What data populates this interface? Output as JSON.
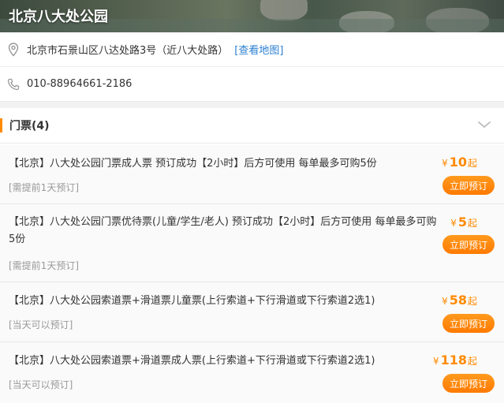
{
  "header": {
    "title": "北京八大处公园"
  },
  "address": {
    "text": "北京市石景山区八达处路3号（近八大处路）",
    "map_link": "[查看地图]",
    "icon": "location-pin-icon"
  },
  "phone": {
    "text": "010-88964661-2186",
    "icon": "phone-icon"
  },
  "tickets_section": {
    "label": "门票(4)",
    "icon": "chevron-down-icon",
    "accent": "#ff8a00"
  },
  "tickets": [
    {
      "name": "【北京】八大处公园门票成人票 预订成功【2小时】后方可使用 每单最多可购5份",
      "note": "[需提前1天预订]",
      "currency": "¥",
      "price": "10",
      "unit": "起",
      "button": "立即预订"
    },
    {
      "name": "【北京】八大处公园门票优待票(儿童/学生/老人) 预订成功【2小时】后方可使用 每单最多可购5份",
      "note": "[需提前1天预订]",
      "currency": "¥",
      "price": "5",
      "unit": "起",
      "button": "立即预订"
    },
    {
      "name": "【北京】八大处公园索道票+滑道票儿童票(上行索道+下行滑道或下行索道2选1)",
      "note": "[当天可以预订]",
      "currency": "¥",
      "price": "58",
      "unit": "起",
      "button": "立即预订"
    },
    {
      "name": "【北京】八大处公园索道票+滑道票成人票(上行索道+下行滑道或下行索道2选1)",
      "note": "[当天可以预订]",
      "currency": "¥",
      "price": "118",
      "unit": "起",
      "button": "立即预订"
    }
  ]
}
